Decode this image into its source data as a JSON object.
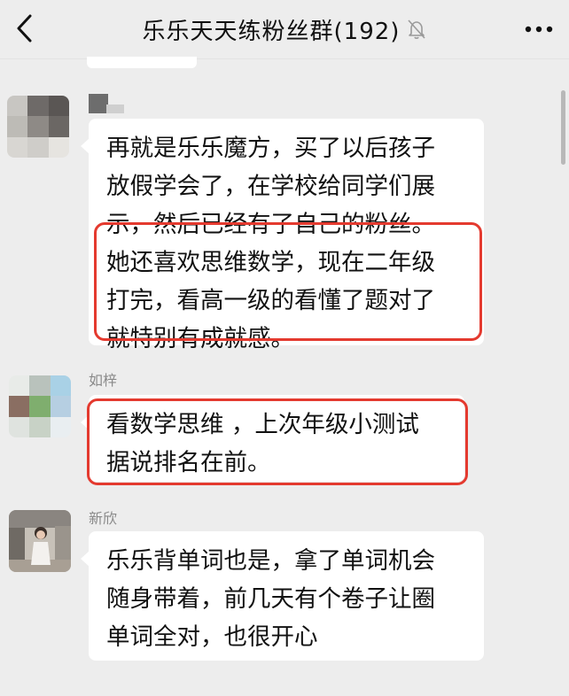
{
  "header": {
    "title": "乐乐天天练粉丝群(192)",
    "icons": {
      "back": "chevron-left-icon",
      "mute": "bell-slash-icon",
      "more": "more-dots-icon"
    }
  },
  "messages": [
    {
      "sender": "",
      "avatar": "blurred-avatar",
      "lines": [
        "再就是乐乐魔方，买了以后孩子",
        "放假学会了，在学校给同学们展",
        "示，然后已经有了自己的粉丝。",
        "她还喜欢思维数学，现在二年级",
        "打完，看高一级的看懂了题对了",
        "就特别有成就感。"
      ],
      "highlight": true
    },
    {
      "sender": "如梓",
      "avatar": "blurred-avatar",
      "lines": [
        "看数学思维 ，上次年级小测试",
        "据说排名在前。"
      ],
      "highlight": true
    },
    {
      "sender": "新欣",
      "avatar": "photo-avatar",
      "lines": [
        "乐乐背单词也是，拿了单词机会",
        "随身带着，前几天有个卷子让圈",
        "单词全对，也很开心"
      ],
      "highlight": false
    }
  ],
  "colors": {
    "background": "#ededed",
    "bubble": "#ffffff",
    "highlight": "#e43a2f"
  }
}
